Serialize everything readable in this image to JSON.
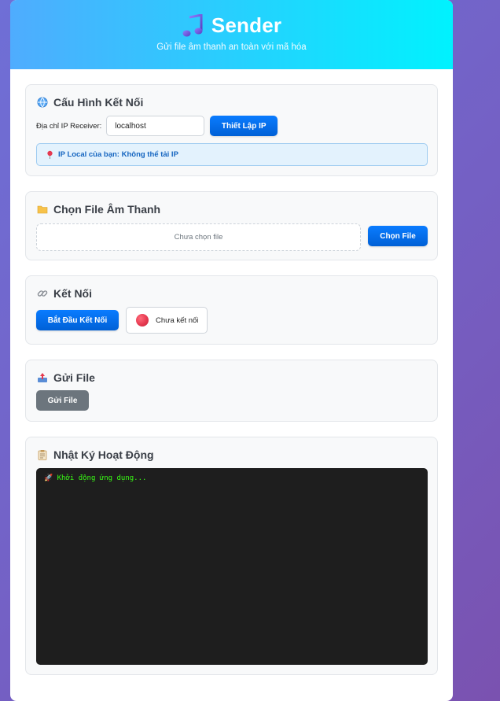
{
  "header": {
    "title": "Sender",
    "title_icon": "music-note-icon",
    "subtitle": "Gửi file âm thanh an toàn với mã hóa"
  },
  "config": {
    "title": "Cấu Hình Kết Nối",
    "icon": "globe-icon",
    "ip_label": "Địa chỉ IP Receiver:",
    "ip_value": "localhost",
    "set_ip_button": "Thiết Lập IP",
    "local_ip_info": "IP Local của bạn: Không thể tải IP",
    "info_icon": "pin-icon"
  },
  "file": {
    "title": "Chọn File Âm Thanh",
    "icon": "folder-icon",
    "placeholder": "Chưa chọn file",
    "choose_button": "Chọn File"
  },
  "connection": {
    "title": "Kết Nối",
    "icon": "link-icon",
    "connect_button": "Bắt Đầu Kết Nối",
    "status": "Chưa kết nối",
    "status_color": "#e63950"
  },
  "send": {
    "title": "Gửi File",
    "icon": "outbox-icon",
    "send_button": "Gửi File"
  },
  "log": {
    "title": "Nhật Ký Hoạt Động",
    "icon": "clipboard-icon",
    "entries": [
      "🚀 Khởi động ứng dụng..."
    ]
  },
  "colors": {
    "header_start": "#4facfe",
    "header_end": "#00f2fe",
    "primary": "#0a7cff",
    "disabled": "#6c757d",
    "log_bg": "#1e1e1e",
    "log_text": "#39ff14"
  }
}
